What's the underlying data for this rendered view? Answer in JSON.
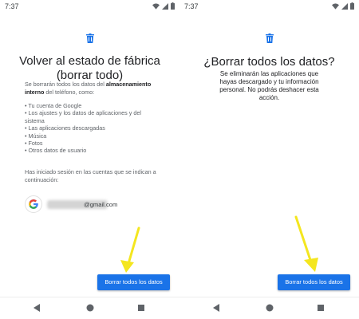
{
  "colors": {
    "accent": "#1a73e8",
    "arrow": "#f4e61f",
    "google_blue": "#4285F4",
    "google_red": "#EA4335",
    "google_yellow": "#FBBC05",
    "google_green": "#34A853"
  },
  "left_screen": {
    "status_time": "7:37",
    "title": "Volver al estado de fábrica (borrar todo)",
    "intro_prefix": "Se borrarán todos los datos del ",
    "intro_bold": "almacenamiento interno",
    "intro_suffix": " del teléfono, como:",
    "items": [
      "• Tu cuenta de Google",
      "• Los ajustes y los datos de aplicaciones y del sistema",
      "• Las aplicaciones descargadas",
      "• Música",
      "• Fotos",
      "• Otros datos de usuario"
    ],
    "accounts_note": "Has iniciado sesión en las cuentas que se indican a continuación:",
    "account_email_domain": "@gmail.com",
    "button_label": "Borrar todos los datos"
  },
  "right_screen": {
    "status_time": "7:37",
    "title": "¿Borrar todos los datos?",
    "description": "Se eliminarán las aplicaciones que hayas descargado y tu información personal. No podrás deshacer esta acción.",
    "button_label": "Borrar todos los datos"
  },
  "icons": [
    "trash-icon",
    "wifi-icon",
    "signal-icon",
    "battery-icon",
    "google-icon",
    "back-icon",
    "home-icon",
    "recents-icon",
    "arrow-icon"
  ]
}
